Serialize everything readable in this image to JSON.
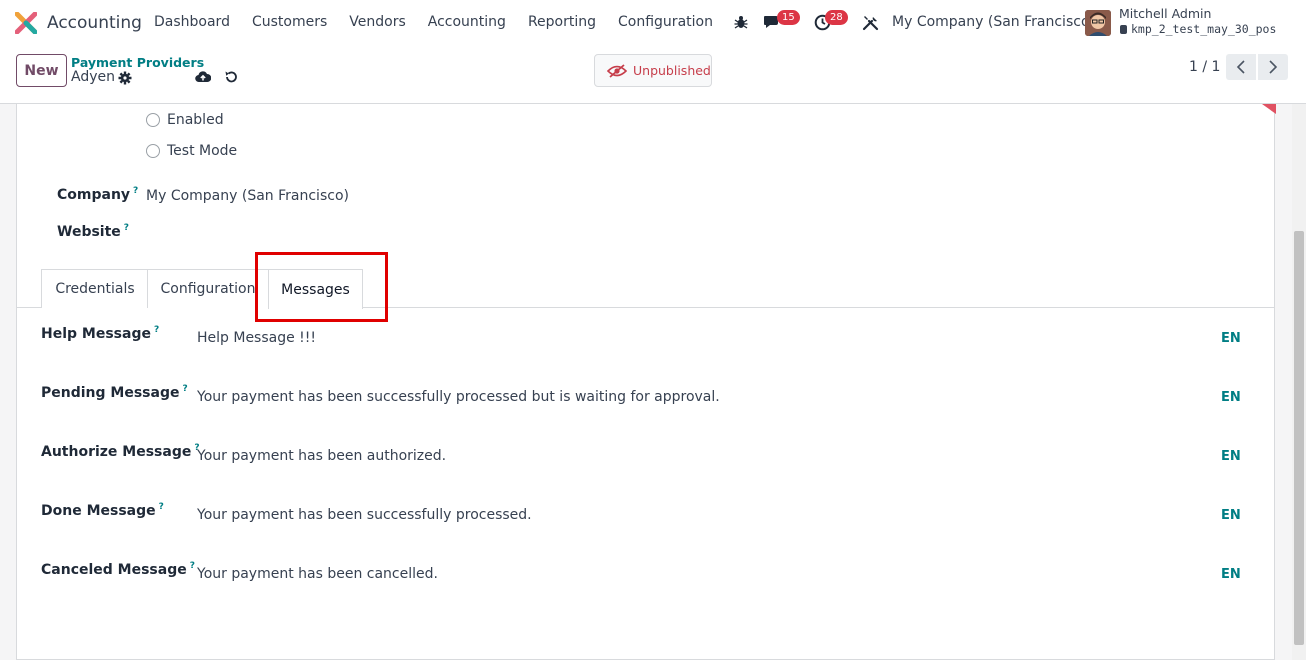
{
  "navbar": {
    "app_name": "Accounting",
    "menu": [
      "Dashboard",
      "Customers",
      "Vendors",
      "Accounting",
      "Reporting",
      "Configuration"
    ],
    "messages_count": "15",
    "activities_count": "28",
    "company": "My Company (San Francisco)",
    "user_name": "Mitchell Admin",
    "database": "kmp_2_test_may_30_pos"
  },
  "control_panel": {
    "new_label": "New",
    "breadcrumb": "Payment Providers",
    "record_name": "Adyen",
    "publish_status": "Unpublished",
    "pager": "1 / 1"
  },
  "form": {
    "state_options": [
      "Enabled",
      "Test Mode"
    ],
    "company_label": "Company",
    "company_value": "My Company (San Francisco)",
    "website_label": "Website",
    "help_mark": "?"
  },
  "tabs": [
    "Credentials",
    "Configuration",
    "Messages"
  ],
  "messages": [
    {
      "label": "Help Message",
      "value": "Help Message !!!",
      "lang": "EN"
    },
    {
      "label": "Pending Message",
      "value": "Your payment has been successfully processed but is waiting for approval.",
      "lang": "EN"
    },
    {
      "label": "Authorize Message",
      "value": "Your payment has been authorized.",
      "lang": "EN"
    },
    {
      "label": "Done Message",
      "value": "Your payment has been successfully processed.",
      "lang": "EN"
    },
    {
      "label": "Canceled Message",
      "value": "Your payment has been cancelled.",
      "lang": "EN"
    }
  ],
  "colors": {
    "brand": "#714b67",
    "accent": "#017e84",
    "badge": "#dc3545",
    "highlight": "#e00000",
    "unpublished": "#c63d4a"
  }
}
